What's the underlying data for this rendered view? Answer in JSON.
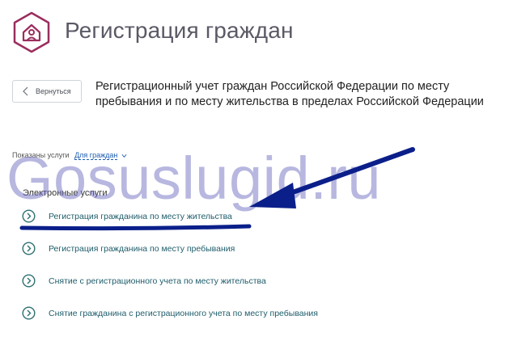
{
  "header": {
    "title": "Регистрация граждан",
    "icon": "house-person-icon",
    "accent_color": "#9b2d5e"
  },
  "back_button": {
    "label": "Вернуться"
  },
  "service": {
    "title": "Регистрационный учет граждан Российской Федерации по месту пребывания и по месту жительства в пределах Российской Федерации"
  },
  "filter": {
    "label": "Показаны услуги",
    "value": "Для граждан"
  },
  "watermark": {
    "text": "Gosuslugid.ru"
  },
  "services_section": {
    "heading": "Электронные услуги",
    "items": [
      {
        "label": "Регистрация гражданина по месту жительства"
      },
      {
        "label": "Регистрация гражданина по месту пребывания"
      },
      {
        "label": "Снятие с регистрационного учета по месту жительства"
      },
      {
        "label": "Снятие гражданина с регистрационного учета по месту пребывания"
      }
    ]
  },
  "colors": {
    "link": "#1e5c6a",
    "filter_link": "#1c5db1",
    "annotation": "#0b1f8a",
    "watermark": "#6969be"
  }
}
